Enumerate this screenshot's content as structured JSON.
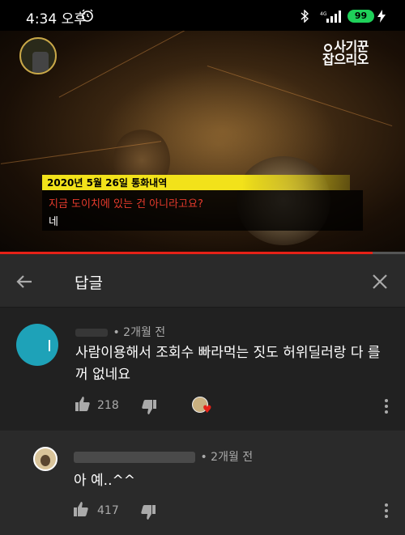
{
  "status_bar": {
    "time": "4:34 오후",
    "battery": "99"
  },
  "video": {
    "brand": "사기꾼 잡으리오",
    "brand_line1": "사기꾼",
    "brand_line2": "잡으리오",
    "date_caption": "2020년 5월 26일 통화내역",
    "caption_question": "지금 도이치에 있는 건 아니라고요?",
    "caption_answer": "네",
    "progress": 0.92
  },
  "reply_header": {
    "title": "답글"
  },
  "comment": {
    "time": "2개월 전",
    "text": "사람이용해서 조회수 빠라먹는 짓도 허위딜러랑 다 를꺼 없네요",
    "likes": "218"
  },
  "reply": {
    "time": "2개월 전",
    "text": "아 예..^^",
    "likes": "417"
  },
  "icons": [
    "alarm-icon",
    "bluetooth-icon",
    "signal-icon",
    "charge-icon",
    "back-icon",
    "close-icon",
    "thumbs-up-icon",
    "thumbs-down-icon",
    "heart-icon",
    "more-vert-icon"
  ],
  "colors": {
    "accent_red": "#e62117",
    "teal_avatar": "#1ea2b8",
    "banner_yellow": "#f2e21a",
    "battery_green": "#1fd15a"
  }
}
